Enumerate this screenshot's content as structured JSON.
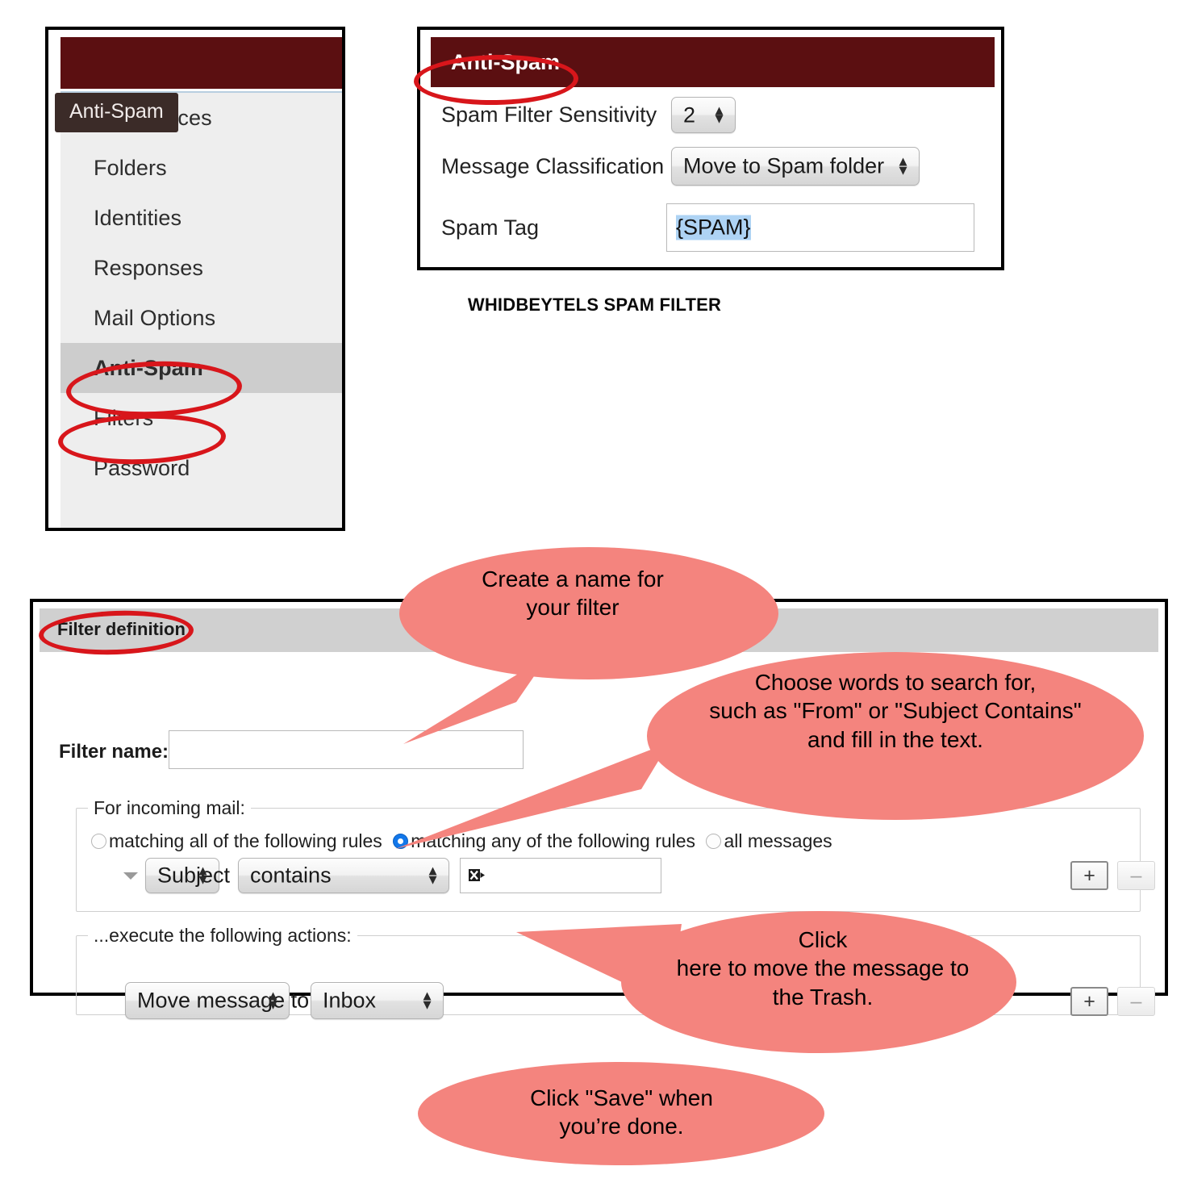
{
  "sidebar": {
    "tooltip": "Anti-Spam",
    "items": [
      {
        "label": "Preferences",
        "active": false
      },
      {
        "label": "Folders",
        "active": false
      },
      {
        "label": "Identities",
        "active": false
      },
      {
        "label": "Responses",
        "active": false
      },
      {
        "label": "Mail Options",
        "active": false
      },
      {
        "label": "Anti-Spam",
        "active": true
      },
      {
        "label": "Filters",
        "active": false
      },
      {
        "label": "Password",
        "active": false
      }
    ]
  },
  "antispam": {
    "title": "Anti-Spam",
    "rows": {
      "sensitivity_label": "Spam Filter Sensitivity",
      "sensitivity_value": "2",
      "classification_label": "Message Classification",
      "classification_value": "Move to Spam folder",
      "spamtag_label": "Spam Tag",
      "spamtag_value": "{SPAM}"
    }
  },
  "caption": "WHIDBEYTELS SPAM FILTER",
  "filter": {
    "header": "Filter definition",
    "name_label": "Filter name:",
    "name_value": "",
    "incoming_legend": "For incoming mail:",
    "radio_all_label": "matching all of the following rules",
    "radio_any_label": "matching any of the following rules",
    "radio_allmsg_label": "all messages",
    "rule": {
      "field": "Subject",
      "operator": "contains",
      "value": "",
      "add_label": "+",
      "remove_label": "–"
    },
    "actions_legend": "...execute the following actions:",
    "action": {
      "type": "Move message to",
      "target": "Inbox",
      "add_label": "+",
      "remove_label": "–"
    }
  },
  "callouts": [
    {
      "id": "name",
      "text": "Create a name for\nyour filter"
    },
    {
      "id": "rules",
      "text": "Choose words to search for,\nsuch as \"From\" or \"Subject  Contains\"\nand fill in the text."
    },
    {
      "id": "trash",
      "text": "Click\nhere to move the message to\nthe Trash."
    },
    {
      "id": "save",
      "text": "Click \"Save\" when\nyou’re done."
    }
  ],
  "colors": {
    "callout": "#F4847E",
    "ink": "#D8161B",
    "titlebar": "#5B0F11",
    "active_item": "#CDCDCD",
    "selection": "#AED3F4",
    "radio_on": "#1277EA"
  }
}
